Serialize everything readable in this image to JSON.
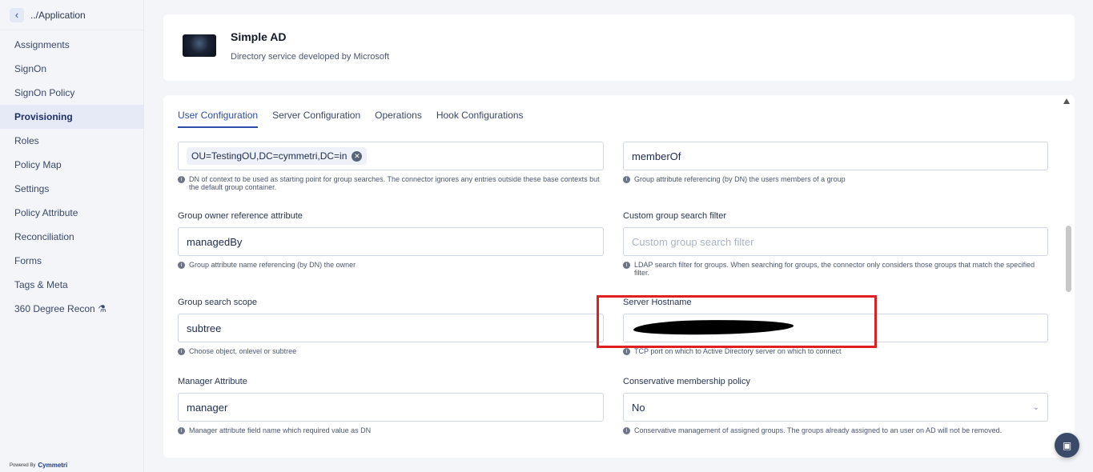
{
  "sidebar": {
    "back_label": "../Application",
    "items": [
      {
        "label": "Assignments"
      },
      {
        "label": "SignOn"
      },
      {
        "label": "SignOn Policy"
      },
      {
        "label": "Provisioning"
      },
      {
        "label": "Roles"
      },
      {
        "label": "Policy Map"
      },
      {
        "label": "Settings"
      },
      {
        "label": "Policy Attribute"
      },
      {
        "label": "Reconciliation"
      },
      {
        "label": "Forms"
      },
      {
        "label": "Tags & Meta"
      },
      {
        "label": "360 Degree Recon ⚗"
      }
    ],
    "active": "Provisioning",
    "powered_by": "Powered By",
    "brand": "Cymmetri"
  },
  "header": {
    "title": "Simple AD",
    "subtitle": "Directory service developed by Microsoft"
  },
  "tabs": [
    {
      "label": "User Configuration"
    },
    {
      "label": "Server Configuration"
    },
    {
      "label": "Operations"
    },
    {
      "label": "Hook Configurations"
    }
  ],
  "fields": {
    "group_base_context": {
      "chip_value": "OU=TestingOU,DC=cymmetri,DC=in",
      "help": "DN of context to be used as starting point for group searches. The connector ignores any entries outside these base contexts but the default group container."
    },
    "group_member_attr": {
      "value": "memberOf",
      "help": "Group attribute referencing (by DN) the users members of a group"
    },
    "group_owner_ref": {
      "label": "Group owner reference attribute",
      "value": "managedBy",
      "help": "Group attribute name referencing (by DN) the owner"
    },
    "custom_group_filter": {
      "label": "Custom group search filter",
      "placeholder": "Custom group search filter",
      "help": "LDAP search filter for groups. When searching for groups, the connector only considers those groups that match the specified filter."
    },
    "group_search_scope": {
      "label": "Group search scope",
      "value": "subtree",
      "help": "Choose object, onlevel or subtree"
    },
    "server_hostname": {
      "label": "Server Hostname",
      "help": "TCP port on which to Active Directory server on which to connect"
    },
    "manager_attr": {
      "label": "Manager Attribute",
      "value": "manager",
      "help": "Manager attribute field name which required value as DN"
    },
    "conservative_policy": {
      "label": "Conservative membership policy",
      "value": "No",
      "help": "Conservative management of assigned groups. The groups already assigned to an user on AD will not be removed."
    }
  }
}
